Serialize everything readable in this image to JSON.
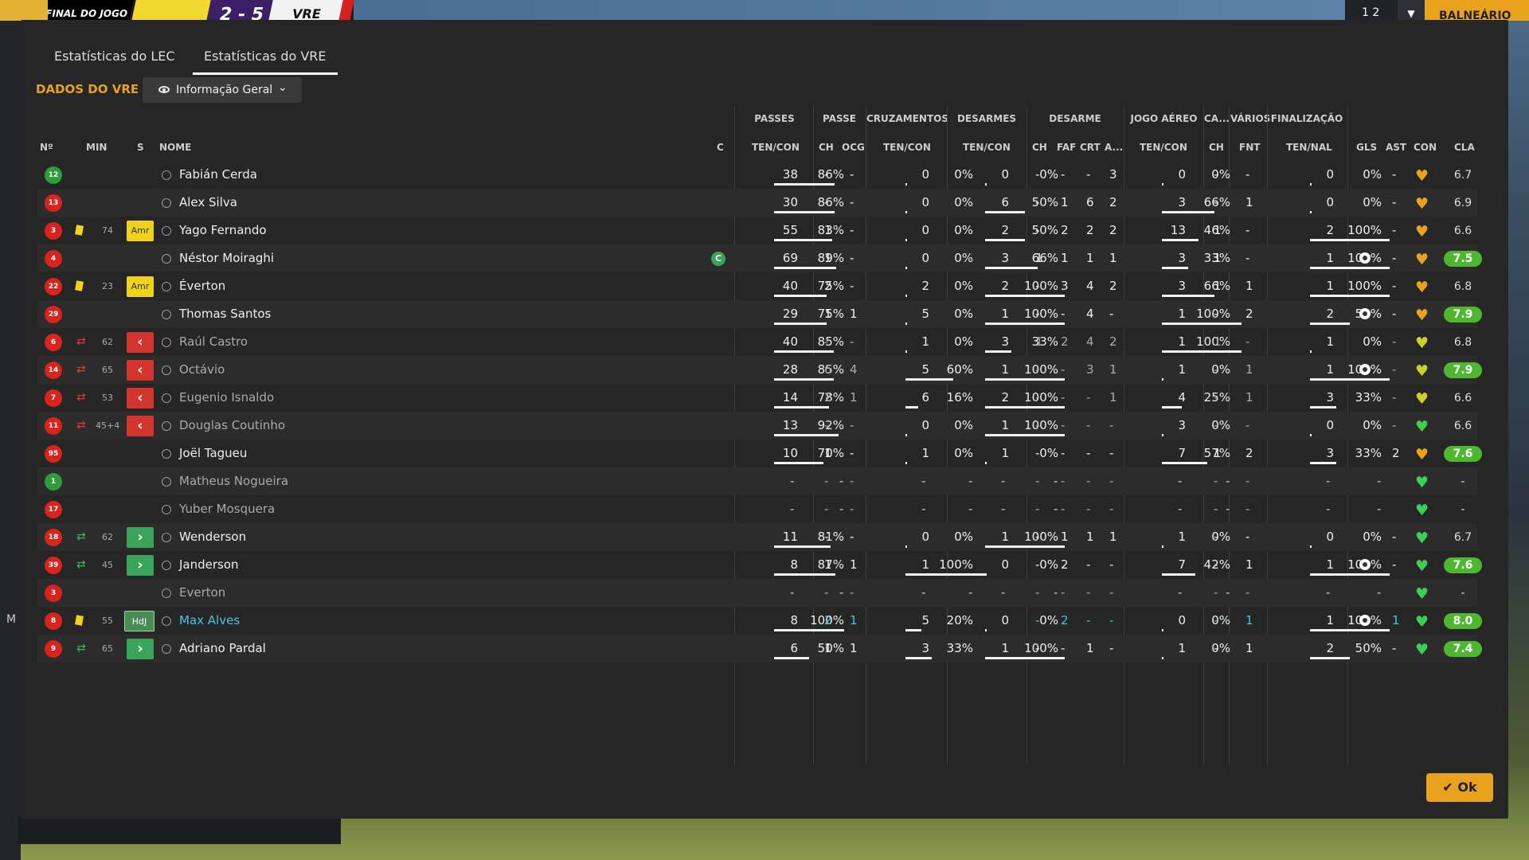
{
  "topbar": {
    "final_label": "FINAL DO JOGO",
    "score": "2 - 5",
    "team_short": "VRE",
    "mid_text": "1 2",
    "right_label": "BALNEÁRIO",
    "left_letter": "M"
  },
  "tabs": [
    {
      "label": "Estatísticas do LEC"
    },
    {
      "label": "Estatísticas do VRE"
    }
  ],
  "team_title": "DADOS DO VRE",
  "dropdown": {
    "label": "Informação Geral"
  },
  "group_headers": [
    "PASSES",
    "PASSE",
    "CRUZAMENTOS",
    "DESARMES",
    "DESARME",
    "JOGO AÉREO",
    "CA...",
    "VÁRIOS",
    "FINALIZAÇÃO"
  ],
  "col_headers": {
    "num": "Nº",
    "min": "MIN",
    "s": "S",
    "nome": "NOME",
    "c": "C",
    "pas_tc": "TEN/CON",
    "ch": "CH",
    "ocg": "OCG",
    "cru_tc": "TEN/CON",
    "des_tc": "TEN/CON",
    "d_ch": "CH",
    "faf": "FAF",
    "crt": "CRT",
    "a": "A...",
    "ja_tc": "TEN/CON",
    "ca_ch": "CH",
    "fnt": "FNT",
    "fin_tn": "TEN/NAL",
    "gls": "GLS",
    "ast": "AST",
    "con": "CON",
    "cla": "CLA"
  },
  "ok_label": "Ok",
  "colors": {
    "accent": "#e8a21e",
    "rating_good": "#4db82f",
    "yellow_card": "#f0d21a",
    "sub_out": "#d3352e",
    "sub_in": "#3aa55a",
    "highlight": "#4fc1e8"
  },
  "players": [
    {
      "shirt": "12",
      "shirt_color": "green",
      "card": false,
      "sub": "",
      "min": "",
      "badge": "",
      "name": "Fabián Cerda",
      "captain": false,
      "passes": [
        38,
        "86%",
        86
      ],
      "passe_ch": "-",
      "passe_ocg": "-",
      "cruz": [
        0,
        "0%",
        0
      ],
      "desarmes": [
        0,
        "0%",
        0
      ],
      "d_ch": "-",
      "faf": "-",
      "crt": "-",
      "a": "3",
      "jogo_aereo": [
        0,
        "0%",
        0
      ],
      "ca_ch": "-",
      "fnt": "-",
      "final": [
        0,
        "0%",
        0
      ],
      "gls": "",
      "ast": "-",
      "con": "orange",
      "cla": "6.7",
      "cla_good": false,
      "style": ""
    },
    {
      "shirt": "13",
      "shirt_color": "red",
      "card": false,
      "sub": "",
      "min": "",
      "badge": "",
      "name": "Alex Silva",
      "captain": false,
      "passes": [
        30,
        "86%",
        86
      ],
      "passe_ch": "-",
      "passe_ocg": "-",
      "cruz": [
        0,
        "0%",
        0
      ],
      "desarmes": [
        6,
        "50%",
        50
      ],
      "d_ch": "-",
      "faf": "1",
      "crt": "6",
      "a": "2",
      "jogo_aereo": [
        3,
        "66%",
        66
      ],
      "ca_ch": "-",
      "fnt": "1",
      "final": [
        0,
        "0%",
        0
      ],
      "gls": "",
      "ast": "-",
      "con": "orange",
      "cla": "6.9",
      "cla_good": false,
      "style": ""
    },
    {
      "shirt": "3",
      "shirt_color": "red",
      "card": true,
      "sub": "",
      "min": "74",
      "badge": "Amr",
      "name": "Yago Fernando",
      "captain": false,
      "passes": [
        55,
        "83%",
        83
      ],
      "passe_ch": "1",
      "passe_ocg": "-",
      "cruz": [
        0,
        "0%",
        0
      ],
      "desarmes": [
        2,
        "50%",
        50
      ],
      "d_ch": "-",
      "faf": "2",
      "crt": "2",
      "a": "2",
      "jogo_aereo": [
        13,
        "46%",
        46
      ],
      "ca_ch": "1",
      "fnt": "-",
      "final": [
        2,
        "100%",
        100
      ],
      "gls": "",
      "ast": "-",
      "con": "orange",
      "cla": "6.6",
      "cla_good": false,
      "style": ""
    },
    {
      "shirt": "4",
      "shirt_color": "red",
      "card": false,
      "sub": "",
      "min": "",
      "badge": "",
      "name": "Néstor Moiraghi",
      "captain": true,
      "captain_label": "C",
      "passes": [
        69,
        "89%",
        89
      ],
      "passe_ch": "1",
      "passe_ocg": "-",
      "cruz": [
        0,
        "0%",
        0
      ],
      "desarmes": [
        3,
        "66%",
        66
      ],
      "d_ch": "1",
      "faf": "1",
      "crt": "1",
      "a": "1",
      "jogo_aereo": [
        3,
        "33%",
        33
      ],
      "ca_ch": "1",
      "fnt": "-",
      "final": [
        1,
        "100%",
        100
      ],
      "gls": "ball",
      "ast": "-",
      "con": "orange",
      "cla": "7.5",
      "cla_good": true,
      "style": ""
    },
    {
      "shirt": "22",
      "shirt_color": "red",
      "card": true,
      "sub": "",
      "min": "23",
      "badge": "Amr",
      "name": "Éverton",
      "captain": false,
      "passes": [
        40,
        "75%",
        75
      ],
      "passe_ch": "2",
      "passe_ocg": "-",
      "cruz": [
        2,
        "0%",
        0
      ],
      "desarmes": [
        2,
        "100%",
        100
      ],
      "d_ch": "-",
      "faf": "3",
      "crt": "4",
      "a": "2",
      "jogo_aereo": [
        3,
        "66%",
        66
      ],
      "ca_ch": "1",
      "fnt": "1",
      "final": [
        1,
        "100%",
        100
      ],
      "gls": "",
      "ast": "-",
      "con": "orange",
      "cla": "6.8",
      "cla_good": false,
      "style": ""
    },
    {
      "shirt": "29",
      "shirt_color": "red",
      "card": false,
      "sub": "",
      "min": "",
      "badge": "",
      "name": "Thomas Santos",
      "captain": false,
      "passes": [
        29,
        "75%",
        75
      ],
      "passe_ch": "1",
      "passe_ocg": "1",
      "cruz": [
        5,
        "0%",
        0
      ],
      "desarmes": [
        1,
        "100%",
        100
      ],
      "d_ch": "-",
      "faf": "-",
      "crt": "4",
      "a": "-",
      "jogo_aereo": [
        1,
        "100%",
        100
      ],
      "ca_ch": "-",
      "fnt": "2",
      "final": [
        2,
        "50%",
        50
      ],
      "gls": "ball",
      "ast": "-",
      "con": "orange",
      "cla": "7.9",
      "cla_good": true,
      "style": ""
    },
    {
      "shirt": "6",
      "shirt_color": "red",
      "card": false,
      "sub": "out",
      "min": "62",
      "badge": "out",
      "name": "Raúl Castro",
      "captain": false,
      "passes": [
        40,
        "85%",
        85
      ],
      "passe_ch": "-",
      "passe_ocg": "-",
      "cruz": [
        1,
        "0%",
        0
      ],
      "desarmes": [
        3,
        "33%",
        33
      ],
      "d_ch": "1",
      "faf": "2",
      "crt": "4",
      "a": "2",
      "jogo_aereo": [
        1,
        "100%",
        100
      ],
      "ca_ch": "1",
      "fnt": "-",
      "final": [
        1,
        "0%",
        0
      ],
      "gls": "",
      "ast": "-",
      "con": "yellow",
      "cla": "6.8",
      "cla_good": false,
      "style": "sub"
    },
    {
      "shirt": "14",
      "shirt_color": "red",
      "card": false,
      "sub": "out",
      "min": "65",
      "badge": "out",
      "name": "Octávio",
      "captain": false,
      "passes": [
        28,
        "85%",
        85
      ],
      "passe_ch": "6",
      "passe_ocg": "4",
      "cruz": [
        5,
        "60%",
        60
      ],
      "desarmes": [
        1,
        "100%",
        100
      ],
      "d_ch": "-",
      "faf": "-",
      "crt": "3",
      "a": "1",
      "jogo_aereo": [
        1,
        "0%",
        0
      ],
      "ca_ch": "-",
      "fnt": "1",
      "final": [
        1,
        "100%",
        100
      ],
      "gls": "ball",
      "ast": "-",
      "con": "yellow",
      "cla": "7.9",
      "cla_good": true,
      "style": "sub"
    },
    {
      "shirt": "7",
      "shirt_color": "red",
      "card": false,
      "sub": "out",
      "min": "53",
      "badge": "out",
      "name": "Eugenio Isnaldo",
      "captain": false,
      "passes": [
        14,
        "78%",
        78
      ],
      "passe_ch": "2",
      "passe_ocg": "1",
      "cruz": [
        6,
        "16%",
        16
      ],
      "desarmes": [
        2,
        "100%",
        100
      ],
      "d_ch": "-",
      "faf": "-",
      "crt": "-",
      "a": "1",
      "jogo_aereo": [
        4,
        "25%",
        25
      ],
      "ca_ch": "-",
      "fnt": "1",
      "final": [
        3,
        "33%",
        33
      ],
      "gls": "",
      "ast": "-",
      "con": "yellow",
      "cla": "6.6",
      "cla_good": false,
      "style": "sub"
    },
    {
      "shirt": "11",
      "shirt_color": "red",
      "card": false,
      "sub": "out",
      "min": "45+4",
      "badge": "out",
      "name": "Douglas Coutinho",
      "captain": false,
      "passes": [
        13,
        "92%",
        92
      ],
      "passe_ch": "-",
      "passe_ocg": "-",
      "cruz": [
        0,
        "0%",
        0
      ],
      "desarmes": [
        1,
        "100%",
        100
      ],
      "d_ch": "-",
      "faf": "-",
      "crt": "-",
      "a": "-",
      "jogo_aereo": [
        3,
        "0%",
        0
      ],
      "ca_ch": "-",
      "fnt": "-",
      "final": [
        0,
        "0%",
        0
      ],
      "gls": "",
      "ast": "-",
      "con": "green",
      "cla": "6.6",
      "cla_good": false,
      "style": "sub"
    },
    {
      "shirt": "95",
      "shirt_color": "red",
      "card": false,
      "sub": "",
      "min": "",
      "badge": "",
      "name": "Joël Tagueu",
      "captain": false,
      "passes": [
        10,
        "70%",
        70
      ],
      "passe_ch": "1",
      "passe_ocg": "-",
      "cruz": [
        1,
        "0%",
        0
      ],
      "desarmes": [
        1,
        "0%",
        0
      ],
      "d_ch": "-",
      "faf": "-",
      "crt": "-",
      "a": "-",
      "jogo_aereo": [
        7,
        "57%",
        57
      ],
      "ca_ch": "1",
      "fnt": "2",
      "final": [
        3,
        "33%",
        33
      ],
      "gls": "",
      "ast": "2",
      "con": "orange",
      "cla": "7.6",
      "cla_good": true,
      "style": ""
    },
    {
      "shirt": "1",
      "shirt_color": "green",
      "card": false,
      "sub": "",
      "min": "",
      "badge": "",
      "name": "Matheus Nogueira",
      "captain": false,
      "passes": null,
      "passe_ch": "-",
      "passe_ocg": "-",
      "cruz": null,
      "desarmes": null,
      "d_ch": "-",
      "faf": "-",
      "crt": "-",
      "a": "-",
      "jogo_aereo": null,
      "ca_ch": "-",
      "fnt": "-",
      "final": null,
      "gls": "",
      "ast": "",
      "con": "green",
      "cla": "-",
      "cla_good": false,
      "style": "sub"
    },
    {
      "shirt": "17",
      "shirt_color": "red",
      "card": false,
      "sub": "",
      "min": "",
      "badge": "",
      "name": "Yuber Mosquera",
      "captain": false,
      "passes": null,
      "passe_ch": "-",
      "passe_ocg": "-",
      "cruz": null,
      "desarmes": null,
      "d_ch": "-",
      "faf": "-",
      "crt": "-",
      "a": "-",
      "jogo_aereo": null,
      "ca_ch": "-",
      "fnt": "-",
      "final": null,
      "gls": "",
      "ast": "",
      "con": "green",
      "cla": "-",
      "cla_good": false,
      "style": "sub"
    },
    {
      "shirt": "18",
      "shirt_color": "red",
      "card": false,
      "sub": "in",
      "min": "62",
      "badge": "in",
      "name": "Wenderson",
      "captain": false,
      "passes": [
        11,
        "81%",
        81
      ],
      "passe_ch": "-",
      "passe_ocg": "-",
      "cruz": [
        0,
        "0%",
        0
      ],
      "desarmes": [
        1,
        "100%",
        100
      ],
      "d_ch": "-",
      "faf": "1",
      "crt": "1",
      "a": "1",
      "jogo_aereo": [
        1,
        "0%",
        0
      ],
      "ca_ch": "-",
      "fnt": "-",
      "final": [
        0,
        "0%",
        0
      ],
      "gls": "",
      "ast": "-",
      "con": "green",
      "cla": "6.7",
      "cla_good": false,
      "style": ""
    },
    {
      "shirt": "39",
      "shirt_color": "red",
      "card": false,
      "sub": "in",
      "min": "45",
      "badge": "in",
      "name": "Janderson",
      "captain": false,
      "passes": [
        8,
        "87%",
        87
      ],
      "passe_ch": "1",
      "passe_ocg": "1",
      "cruz": [
        1,
        "100%",
        100
      ],
      "desarmes": [
        0,
        "0%",
        0
      ],
      "d_ch": "-",
      "faf": "2",
      "crt": "-",
      "a": "-",
      "jogo_aereo": [
        7,
        "42%",
        42
      ],
      "ca_ch": "-",
      "fnt": "1",
      "final": [
        1,
        "100%",
        100
      ],
      "gls": "ball",
      "ast": "-",
      "con": "green",
      "cla": "7.6",
      "cla_good": true,
      "style": ""
    },
    {
      "shirt": "3",
      "shirt_color": "red",
      "card": false,
      "sub": "",
      "min": "",
      "badge": "",
      "name": "Everton",
      "captain": false,
      "passes": null,
      "passe_ch": "-",
      "passe_ocg": "-",
      "cruz": null,
      "desarmes": null,
      "d_ch": "-",
      "faf": "-",
      "crt": "-",
      "a": "-",
      "jogo_aereo": null,
      "ca_ch": "-",
      "fnt": "-",
      "final": null,
      "gls": "",
      "ast": "",
      "con": "green",
      "cla": "-",
      "cla_good": false,
      "style": "sub"
    },
    {
      "shirt": "8",
      "shirt_color": "red",
      "card": true,
      "sub": "",
      "min": "55",
      "badge": "HdJ",
      "name": "Max Alves",
      "captain": false,
      "passes": [
        8,
        "100%",
        100
      ],
      "passe_ch": "2",
      "passe_ocg": "1",
      "cruz": [
        5,
        "20%",
        20
      ],
      "desarmes": [
        0,
        "0%",
        0
      ],
      "d_ch": "-",
      "faf": "2",
      "crt": "-",
      "a": "-",
      "jogo_aereo": [
        0,
        "0%",
        0
      ],
      "ca_ch": "-",
      "fnt": "1",
      "final": [
        1,
        "100%",
        100
      ],
      "gls": "ball",
      "ast": "1",
      "con": "green",
      "cla": "8.0",
      "cla_good": true,
      "style": "hl"
    },
    {
      "shirt": "9",
      "shirt_color": "red",
      "card": false,
      "sub": "in",
      "min": "65",
      "badge": "in",
      "name": "Adriano Pardal",
      "captain": false,
      "passes": [
        6,
        "50%",
        50
      ],
      "passe_ch": "1",
      "passe_ocg": "1",
      "cruz": [
        3,
        "33%",
        33
      ],
      "desarmes": [
        1,
        "100%",
        100
      ],
      "d_ch": "-",
      "faf": "-",
      "crt": "1",
      "a": "-",
      "jogo_aereo": [
        1,
        "0%",
        0
      ],
      "ca_ch": "-",
      "fnt": "1",
      "final": [
        2,
        "50%",
        50
      ],
      "gls": "",
      "ast": "-",
      "con": "green",
      "cla": "7.4",
      "cla_good": true,
      "style": ""
    }
  ]
}
